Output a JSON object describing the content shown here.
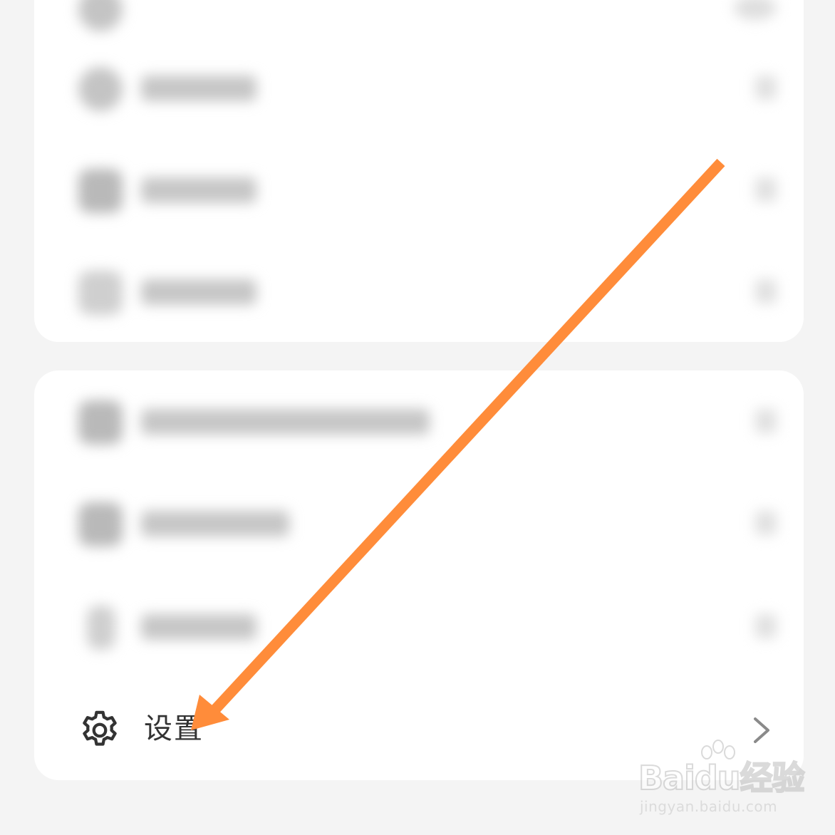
{
  "settings_row": {
    "label": "设置",
    "icon": "gear-icon",
    "chevron": "chevron-right-icon"
  },
  "annotation": {
    "arrow_color": "#ff8c3a"
  },
  "watermark": {
    "logo_text_1": "Bai",
    "logo_text_2": "du",
    "logo_text_3": "经验",
    "url": "jingyan.baidu.com"
  },
  "colors": {
    "background": "#f4f4f4",
    "card": "#ffffff",
    "text": "#333333"
  }
}
